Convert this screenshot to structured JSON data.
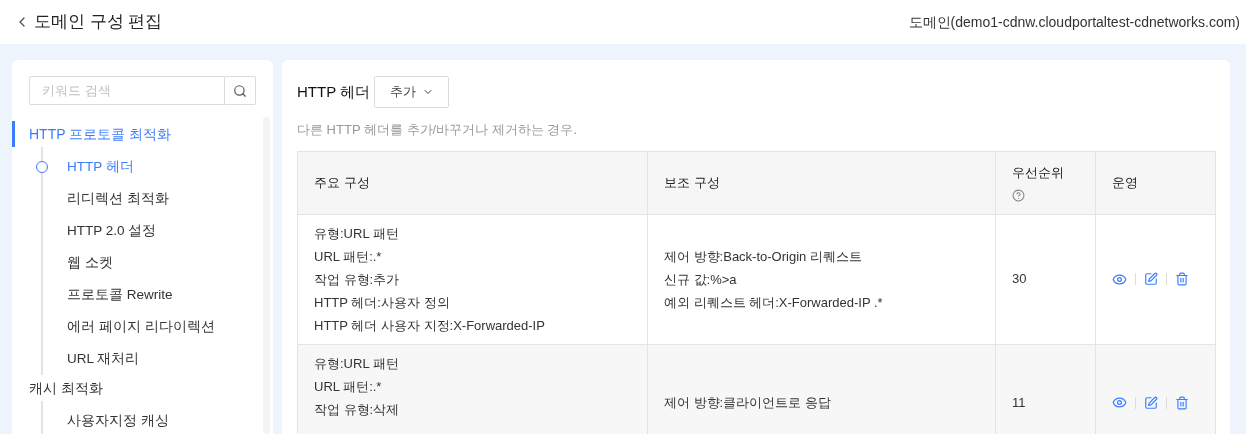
{
  "header": {
    "title": "도메인 구성 편집",
    "domain": "도메인(demo1-cdnw.cloudportaltest-cdnetworks.com)"
  },
  "sidebar": {
    "search": {
      "placeholder": "키워드 검색"
    },
    "items": [
      {
        "label": "HTTP 프로토콜 최적화",
        "selected": true,
        "children": [
          {
            "label": "HTTP 헤더",
            "selected": true
          },
          {
            "label": "리디렉션 최적화",
            "selected": false
          },
          {
            "label": "HTTP 2.0 설정",
            "selected": false
          },
          {
            "label": "웹 소켓",
            "selected": false
          },
          {
            "label": "프로토콜 Rewrite",
            "selected": false
          },
          {
            "label": "에러 페이지 리다이렉션",
            "selected": false
          },
          {
            "label": "URL 재처리",
            "selected": false
          }
        ]
      },
      {
        "label": "캐시 최적화",
        "selected": false,
        "children": [
          {
            "label": "사용자지정 캐싱",
            "selected": false
          }
        ]
      }
    ]
  },
  "section": {
    "title": "HTTP 헤더",
    "add_button": "추가",
    "description": "다른 HTTP 헤더를 추가/바꾸거나 제거하는 경우."
  },
  "table": {
    "columns": [
      {
        "label": "주요 구성",
        "help": false
      },
      {
        "label": "보조 구성",
        "help": false
      },
      {
        "label": "우선순위",
        "help": true
      },
      {
        "label": "운영",
        "help": false
      }
    ],
    "rows": [
      {
        "highlighted": false,
        "primary": [
          "유형:URL 패턴",
          "URL 패턴:.*",
          "작업 유형:추가",
          "HTTP 헤더:사용자 정의",
          "HTTP 헤더 사용자 지정:X-Forwarded-IP"
        ],
        "secondary": [
          "제어 방향:Back-to-Origin 리퀘스트",
          "신규 값:%>a",
          "예외 리퀘스트 헤더:X-Forwarded-IP .*"
        ],
        "priority": "30"
      },
      {
        "highlighted": true,
        "primary": [
          "유형:URL 패턴",
          "URL 패턴:.*",
          "작업 유형:삭제"
        ],
        "secondary": [
          "제어 방향:클라이언트로 응답"
        ],
        "priority": "11"
      }
    ]
  }
}
